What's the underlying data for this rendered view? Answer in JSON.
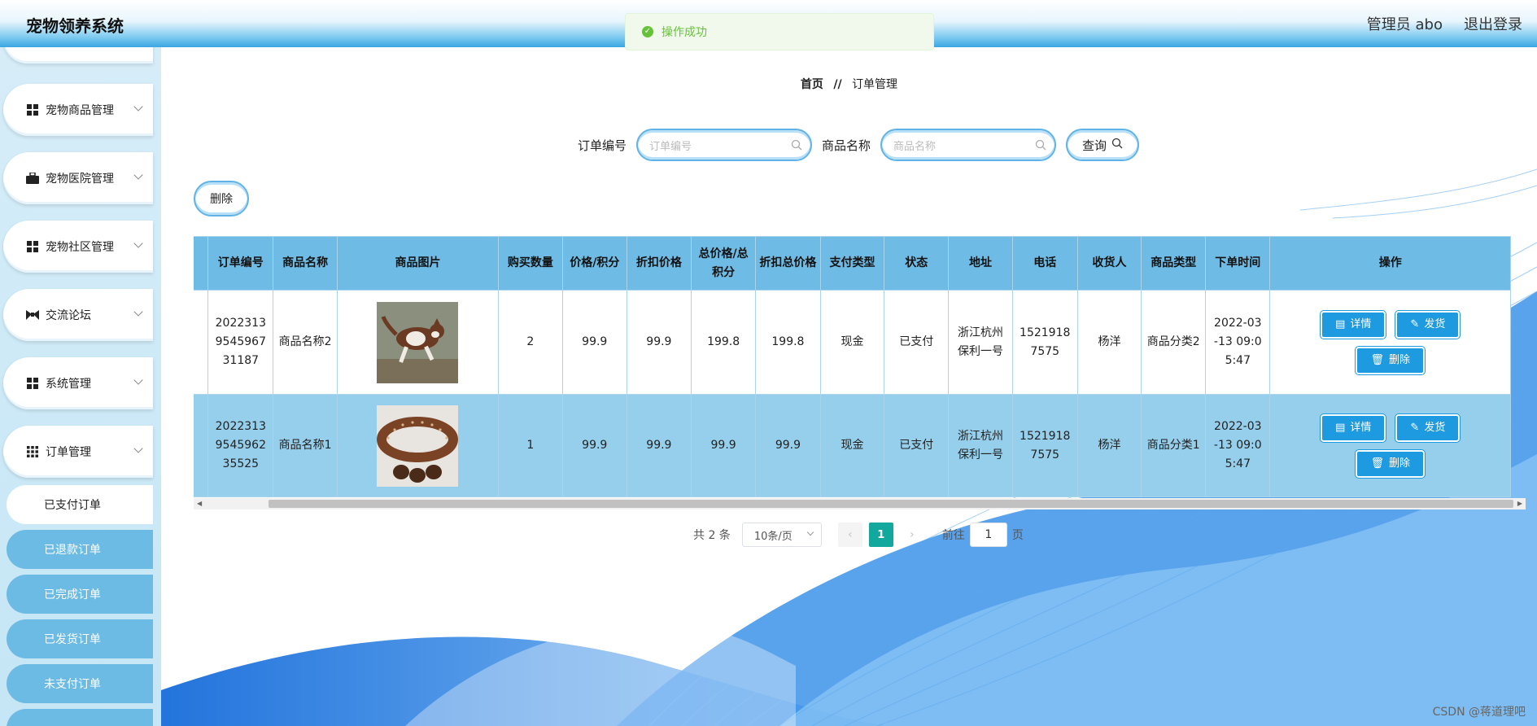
{
  "app": {
    "title": "宠物领养系统"
  },
  "header": {
    "user": "管理员 abo",
    "logout": "退出登录"
  },
  "toast": {
    "message": "操作成功"
  },
  "sidebar": {
    "items": [
      {
        "label": "宠物商品管理",
        "icon": "grid-icon"
      },
      {
        "label": "宠物医院管理",
        "icon": "briefcase-icon"
      },
      {
        "label": "宠物社区管理",
        "icon": "grid-icon"
      },
      {
        "label": "交流论坛",
        "icon": "bowtie-icon"
      },
      {
        "label": "系统管理",
        "icon": "grid-icon"
      },
      {
        "label": "订单管理",
        "icon": "apps-icon"
      }
    ],
    "sub_items": [
      {
        "label": "已支付订单",
        "active": true
      },
      {
        "label": "已退款订单"
      },
      {
        "label": "已完成订单"
      },
      {
        "label": "已发货订单"
      },
      {
        "label": "未支付订单"
      }
    ]
  },
  "breadcrumb": {
    "home": "首页",
    "separator": "//",
    "current": "订单管理"
  },
  "search": {
    "order_label": "订单编号",
    "order_placeholder": "订单编号",
    "product_label": "商品名称",
    "product_placeholder": "商品名称",
    "query_label": "查询"
  },
  "toolbar": {
    "delete_label": "删除"
  },
  "table": {
    "headers": [
      "订单编号",
      "商品名称",
      "商品图片",
      "购买数量",
      "价格/积分",
      "折扣价格",
      "总价格/总积分",
      "折扣总价格",
      "支付类型",
      "状态",
      "地址",
      "电话",
      "收货人",
      "商品类型",
      "下单时间",
      "操作"
    ],
    "rows": [
      {
        "order_no": "2022313 9545967 31187",
        "name": "商品名称2",
        "image": "dog-photo",
        "qty": "2",
        "price": "99.9",
        "discount_price": "99.9",
        "total": "199.8",
        "discount_total": "199.8",
        "pay_type": "现金",
        "status": "已支付",
        "address": "浙江杭州保利一号",
        "phone": "1521918 7575",
        "receiver": "杨洋",
        "category": "商品分类2",
        "time": "2022-03 -13 09:0 5:47"
      },
      {
        "order_no": "2022313 9545962 35525",
        "name": "商品名称1",
        "image": "collar-photo",
        "qty": "1",
        "price": "99.9",
        "discount_price": "99.9",
        "total": "99.9",
        "discount_total": "99.9",
        "pay_type": "现金",
        "status": "已支付",
        "address": "浙江杭州保利一号",
        "phone": "1521918 7575",
        "receiver": "杨洋",
        "category": "商品分类1",
        "time": "2022-03 -13 09:0 5:47"
      }
    ],
    "actions": {
      "detail": "详情",
      "ship": "发货",
      "delete": "删除"
    }
  },
  "pagination": {
    "total": "共 2 条",
    "page_size": "10条/页",
    "current": "1",
    "goto": "前往",
    "goto_value": "1",
    "page_unit": "页"
  },
  "watermark": "CSDN @蒋道理吧",
  "colors": {
    "accent": "#1e9ae0",
    "header": "#3aa6e3",
    "success": "#67c23a",
    "page_active": "#13a89e"
  }
}
